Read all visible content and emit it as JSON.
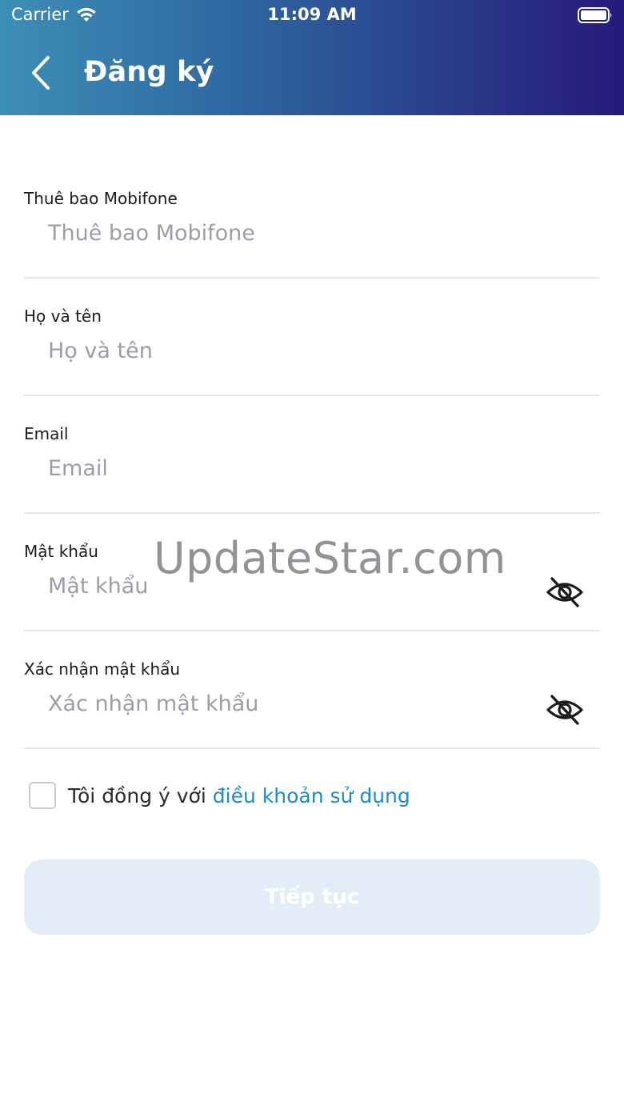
{
  "status_bar": {
    "carrier": "Carrier",
    "time": "11:09 AM",
    "icons": [
      "wifi-icon",
      "battery-icon"
    ]
  },
  "header": {
    "title": "Đăng ký",
    "back_icon": "chevron-left-icon",
    "gradient": [
      "#3d8fb6",
      "#2f6aa3",
      "#2a3f8c",
      "#26197a"
    ]
  },
  "form": {
    "phone": {
      "label": "Thuê bao Mobifone",
      "placeholder": "Thuê bao Mobifone",
      "value": ""
    },
    "fullname": {
      "label": "Họ và tên",
      "placeholder": "Họ và tên",
      "value": ""
    },
    "email": {
      "label": "Email",
      "placeholder": "Email",
      "value": ""
    },
    "password": {
      "label": "Mật khẩu",
      "placeholder": "Mật khẩu",
      "value": "",
      "toggle_icon": "eye-off-icon"
    },
    "confirm_password": {
      "label": "Xác nhận mật khẩu",
      "placeholder": "Xác nhận mật khẩu",
      "value": "",
      "toggle_icon": "eye-off-icon"
    }
  },
  "terms": {
    "checked": false,
    "text": "Tôi đồng ý với",
    "link_text": "điều khoản sử dụng",
    "link_color": "#1f8cc9"
  },
  "continue_button": {
    "label": "Tiếp tục",
    "disabled": true,
    "background": "#e3edf8"
  },
  "watermark": "UpdateStar.com"
}
